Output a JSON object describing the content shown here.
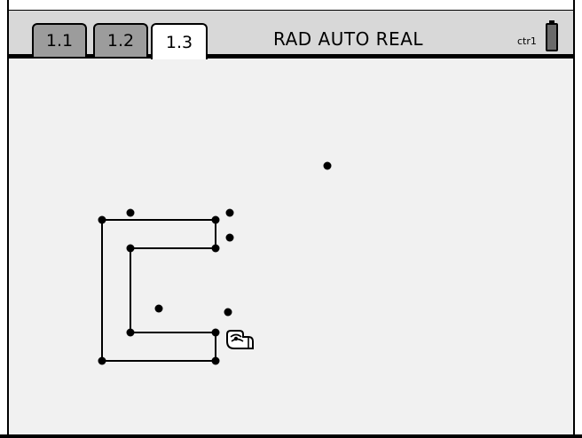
{
  "tabs": [
    {
      "label": "1.1",
      "active": false
    },
    {
      "label": "1.2",
      "active": false
    },
    {
      "label": "1.3",
      "active": true
    }
  ],
  "status": {
    "mode": "RAD AUTO REAL",
    "document": "ctr1"
  },
  "icons": {
    "battery": "battery-icon",
    "cursor": "grab-hand-cursor-icon"
  },
  "colors": {
    "header_bg": "#d8d8d8",
    "tab_inactive": "#9c9c9c",
    "tab_active": "#ffffff",
    "canvas_bg": "#f1f1f1",
    "ink": "#000000"
  }
}
